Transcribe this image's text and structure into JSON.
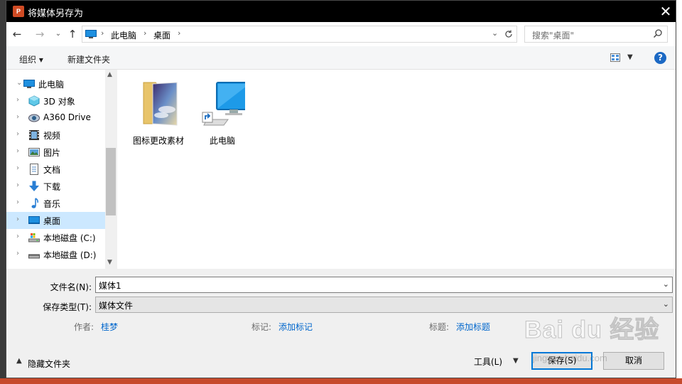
{
  "window": {
    "title": "将媒体另存为",
    "app_icon_text": "P",
    "close_glyph": "✕"
  },
  "navigation": {
    "back_glyph": "←",
    "forward_glyph": "→",
    "recent_glyph": "⌄",
    "up_glyph": "↑",
    "breadcrumb": [
      "此电脑",
      "桌面"
    ],
    "search_placeholder": "搜索\"桌面\""
  },
  "toolbar": {
    "organize_label": "组织",
    "new_folder_label": "新建文件夹",
    "help_glyph": "?"
  },
  "nav_tree": {
    "root": {
      "label": "此电脑",
      "icon": "pc-icon"
    },
    "items": [
      {
        "label": "3D 对象",
        "icon": "3d-objects-icon",
        "selected": false
      },
      {
        "label": "A360 Drive",
        "icon": "a360-drive-icon",
        "selected": false
      },
      {
        "label": "视频",
        "icon": "video-icon",
        "selected": false
      },
      {
        "label": "图片",
        "icon": "pictures-icon",
        "selected": false
      },
      {
        "label": "文档",
        "icon": "documents-icon",
        "selected": false
      },
      {
        "label": "下载",
        "icon": "downloads-icon",
        "selected": false
      },
      {
        "label": "音乐",
        "icon": "music-icon",
        "selected": false
      },
      {
        "label": "桌面",
        "icon": "desktop-icon",
        "selected": true
      },
      {
        "label": "本地磁盘 (C:)",
        "icon": "drive-c-icon",
        "selected": false
      },
      {
        "label": "本地磁盘 (D:)",
        "icon": "drive-d-icon",
        "selected": false
      }
    ]
  },
  "files": [
    {
      "label": "图标更改素材",
      "icon": "image-folder-icon"
    },
    {
      "label": "此电脑",
      "icon": "pc-shortcut-icon"
    }
  ],
  "form": {
    "filename_label": "文件名(N):",
    "filename_value": "媒体1",
    "filetype_label": "保存类型(T):",
    "filetype_value": "媒体文件",
    "author_label": "作者:",
    "author_value": "桂梦",
    "tags_label": "标记:",
    "tags_value": "添加标记",
    "subject_label": "标题:",
    "subject_value": "添加标题"
  },
  "footer": {
    "hide_folders_label": "隐藏文件夹",
    "tools_label": "工具(L)",
    "save_label": "保存(S)",
    "cancel_label": "取消"
  },
  "watermark": {
    "main": "Bai du 经验",
    "sub": "jingyan.baidu.com"
  },
  "colors": {
    "selection": "#cce8ff",
    "link": "#0066cc",
    "primary_border": "#0078d7",
    "app_icon": "#d04b24"
  }
}
